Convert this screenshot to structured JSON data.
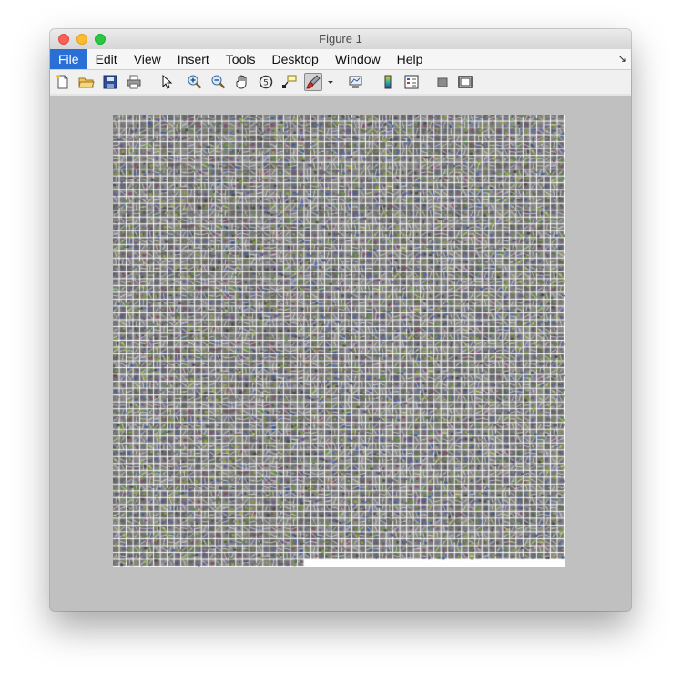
{
  "window": {
    "title": "Figure 1",
    "traffic_lights": [
      "close",
      "minimize",
      "zoom"
    ]
  },
  "menubar": {
    "items": [
      {
        "label": "File",
        "active": true
      },
      {
        "label": "Edit"
      },
      {
        "label": "View"
      },
      {
        "label": "Insert"
      },
      {
        "label": "Tools"
      },
      {
        "label": "Desktop"
      },
      {
        "label": "Window"
      },
      {
        "label": "Help"
      }
    ],
    "dock_arrow": "↘"
  },
  "toolbar": {
    "buttons": [
      {
        "name": "new-figure-icon"
      },
      {
        "name": "open-file-icon"
      },
      {
        "name": "save-icon"
      },
      {
        "name": "print-icon"
      },
      {
        "name": "edit-plot-arrow-icon"
      },
      {
        "name": "zoom-in-icon"
      },
      {
        "name": "zoom-out-icon"
      },
      {
        "name": "pan-hand-icon"
      },
      {
        "name": "rotate-3d-icon"
      },
      {
        "name": "data-cursor-icon"
      },
      {
        "name": "brush-icon"
      },
      {
        "name": "brush-dropdown-icon"
      },
      {
        "name": "link-plot-icon"
      },
      {
        "name": "insert-colorbar-icon"
      },
      {
        "name": "insert-legend-icon"
      },
      {
        "name": "hide-plot-tools-icon"
      },
      {
        "name": "show-plot-tools-icon"
      }
    ]
  },
  "figure": {
    "background_color": "#c0c0c0",
    "image_description": "montage of small color-filter patches on a grid with white separators; last row partially filled",
    "grid_columns": 66,
    "grid_rows": 66,
    "filled_tiles_last_row": 28,
    "separator_color": "#ffffff",
    "patch_colors": [
      "#7a7a7a",
      "#707070",
      "#858585",
      "#6a6a6a",
      "#5b8f3e",
      "#7d9a3a",
      "#3f5fa0",
      "#8a4a6a",
      "#5a6bb0",
      "#9aa640",
      "#6d5a8f",
      "#4a4a4a",
      "#9a9a9a"
    ]
  }
}
